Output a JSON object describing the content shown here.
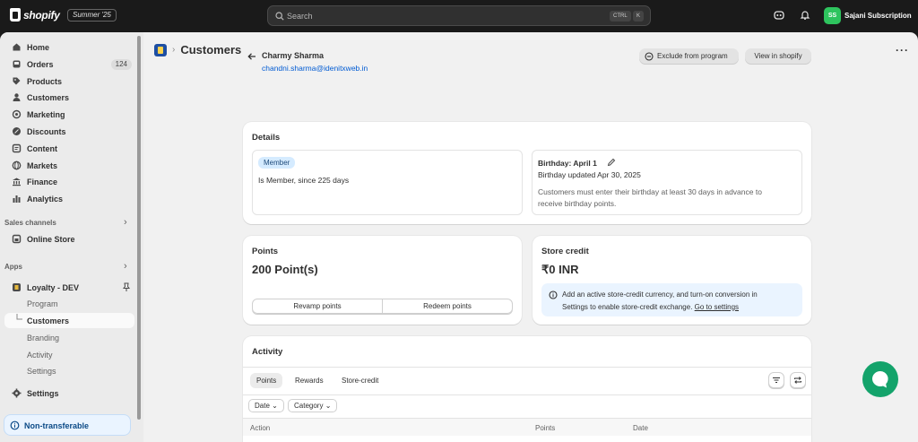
{
  "topbar": {
    "brand": "shopify",
    "edition": "Summer '25",
    "search_placeholder": "Search",
    "kbd1": "CTRL",
    "kbd2": "K",
    "store_initials": "SS",
    "store_name": "Sajani Subscription"
  },
  "sidebar": {
    "items": [
      {
        "label": "Home",
        "icon": "home-icon"
      },
      {
        "label": "Orders",
        "icon": "orders-icon",
        "badge": "124"
      },
      {
        "label": "Products",
        "icon": "tag-icon"
      },
      {
        "label": "Customers",
        "icon": "person-icon"
      },
      {
        "label": "Marketing",
        "icon": "target-icon"
      },
      {
        "label": "Discounts",
        "icon": "discount-icon"
      },
      {
        "label": "Content",
        "icon": "content-icon"
      },
      {
        "label": "Markets",
        "icon": "globe-icon"
      },
      {
        "label": "Finance",
        "icon": "bank-icon"
      },
      {
        "label": "Analytics",
        "icon": "chart-icon"
      }
    ],
    "sales_channels_label": "Sales channels",
    "online_store": "Online Store",
    "apps_label": "Apps",
    "app_name": "Loyalty - DEV",
    "app_subitems": [
      "Program",
      "Customers",
      "Branding",
      "Activity",
      "Settings"
    ],
    "settings": "Settings",
    "non_transferable": "Non-transferable"
  },
  "header": {
    "title": "Customers",
    "more": "···"
  },
  "customer": {
    "name": "Charmy Sharma",
    "email": "chandni.sharma@idenitxweb.in",
    "exclude_button": "Exclude from program",
    "view_button": "View in shopify"
  },
  "details": {
    "title": "Details",
    "tag": "Member",
    "member_since": "Is Member, since 225 days",
    "birthday_title": "Birthday: April 1",
    "birthday_updated": "Birthday updated Apr 30, 2025",
    "birthday_note_1": "Customers must enter their birthday at least 30 days in advance to",
    "birthday_note_2": "receive birthday points."
  },
  "points": {
    "title": "Points",
    "value": "200 Point(s)",
    "revamp": "Revamp points",
    "redeem": "Redeem points"
  },
  "store_credit": {
    "title": "Store credit",
    "value": "₹0 INR",
    "info_1": "Add an active store-credit currency, and turn-on conversion in",
    "info_2": "Settings to enable store-credit exchange.",
    "link": "Go to settings"
  },
  "activity": {
    "title": "Activity",
    "tabs": [
      "Points",
      "Rewards",
      "Store-credit"
    ],
    "filters": [
      "Date",
      "Category"
    ],
    "columns": [
      "Action",
      "Points",
      "Date"
    ]
  }
}
